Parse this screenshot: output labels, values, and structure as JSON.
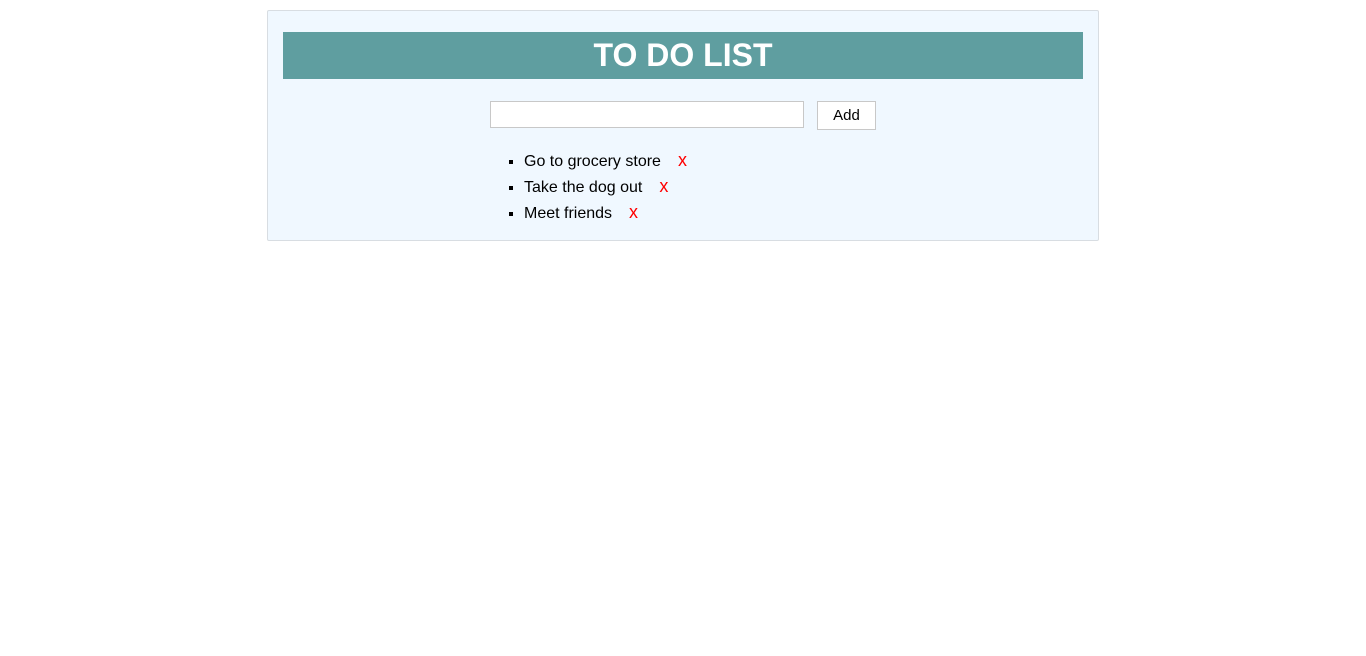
{
  "header": {
    "title": "TO DO LIST"
  },
  "form": {
    "input_value": "",
    "add_label": "Add"
  },
  "todos": [
    {
      "text": "Go to grocery store",
      "delete_label": "x"
    },
    {
      "text": "Take the dog out",
      "delete_label": "x"
    },
    {
      "text": "Meet friends",
      "delete_label": "x"
    }
  ],
  "colors": {
    "header_bg": "#5f9ea0",
    "card_bg": "#f0f8ff",
    "delete": "#ff0000"
  }
}
